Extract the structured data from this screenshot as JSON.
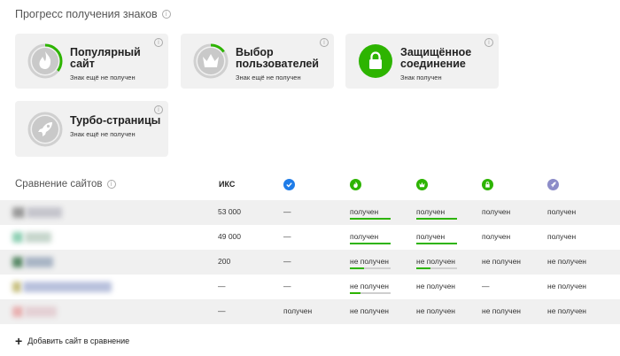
{
  "header": {
    "title": "Прогресс получения знаков"
  },
  "badges": [
    {
      "name": "Популярный сайт",
      "status": "Знак ещё не получен",
      "icon": "flame-icon",
      "progress": 0.35
    },
    {
      "name": "Выбор пользователей",
      "status": "Знак ещё не получен",
      "icon": "crown-icon",
      "progress": 0.15
    },
    {
      "name": "Защищённое соединение",
      "status": "Знак получен",
      "icon": "lock-icon",
      "progress": 1
    },
    {
      "name": "Турбо-страницы",
      "status": "Знак ещё не получен",
      "icon": "rocket-icon",
      "progress": 0
    }
  ],
  "comparison": {
    "title": "Сравнение сайтов",
    "columns": {
      "iks": "ИКС",
      "icons": [
        "verified-icon",
        "flame-icon",
        "crown-icon",
        "lock-icon",
        "rocket-icon"
      ]
    },
    "rows": [
      {
        "iks": "53 000",
        "verified": "—",
        "popular": "получен",
        "popular_progress": 1,
        "choice": "получен",
        "choice_progress": 1,
        "secure": "получен",
        "turbo": "получен"
      },
      {
        "iks": "49 000",
        "verified": "—",
        "popular": "получен",
        "popular_progress": 1,
        "choice": "получен",
        "choice_progress": 1,
        "secure": "получен",
        "turbo": "получен"
      },
      {
        "iks": "200",
        "verified": "—",
        "popular": "не получен",
        "popular_progress": 0.35,
        "choice": "не получен",
        "choice_progress": 0.35,
        "secure": "не получен",
        "turbo": "не получен"
      },
      {
        "iks": "—",
        "verified": "—",
        "popular": "не получен",
        "popular_progress": 0.25,
        "choice": "не получен",
        "choice_progress": 0,
        "secure": "—",
        "turbo": "не получен"
      },
      {
        "iks": "—",
        "verified": "получен",
        "popular": "не получен",
        "popular_progress": 0,
        "choice": "не получен",
        "choice_progress": 0,
        "secure": "не получен",
        "turbo": "не получен"
      }
    ]
  },
  "add_site": {
    "label": "Добавить сайт в сравнение"
  },
  "colors": {
    "green": "#2db400",
    "grey_badge": "#c9c9c9",
    "blue": "#1f7ce8",
    "rocket": "#8c8cc8"
  }
}
